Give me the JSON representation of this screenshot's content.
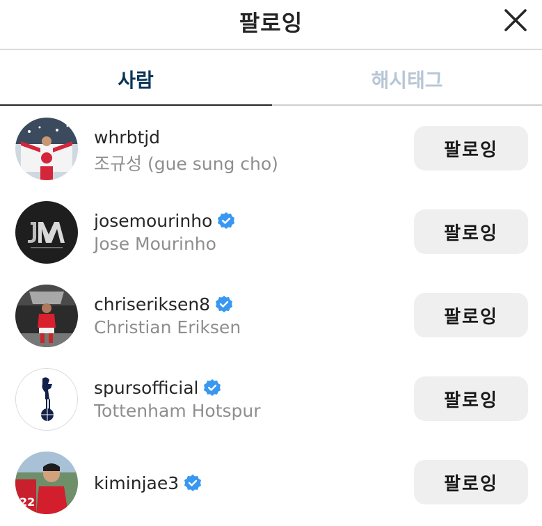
{
  "header": {
    "title": "팔로잉"
  },
  "tabs": [
    {
      "label": "사람",
      "active": true
    },
    {
      "label": "해시태그",
      "active": false
    }
  ],
  "colors": {
    "verified": "#3897f0",
    "active_tab": "#0b3557",
    "inactive_tab": "#b7c6d5",
    "button_bg": "#efefef"
  },
  "users": [
    {
      "username": "whrbtjd",
      "full_name": "조규성 (gue sung cho)",
      "verified": false,
      "button": "팔로잉"
    },
    {
      "username": "josemourinho",
      "full_name": "Jose Mourinho",
      "verified": true,
      "button": "팔로잉"
    },
    {
      "username": "chriseriksen8",
      "full_name": "Christian Eriksen",
      "verified": true,
      "button": "팔로잉"
    },
    {
      "username": "spursofficial",
      "full_name": "Tottenham Hotspur",
      "verified": true,
      "button": "팔로잉"
    },
    {
      "username": "kiminjae3",
      "full_name": "",
      "verified": true,
      "button": "팔로잉"
    }
  ]
}
